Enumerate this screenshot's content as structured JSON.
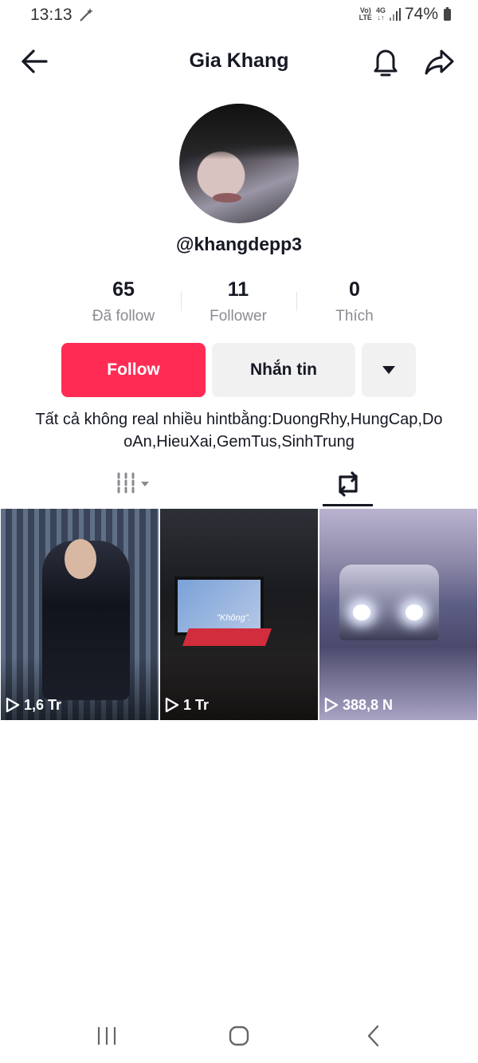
{
  "status_bar": {
    "time": "13:13",
    "network_top": "Vo)",
    "network_bottom": "LTE",
    "network_type": "4G",
    "battery_percent": "74%"
  },
  "header": {
    "title": "Gia Khang",
    "icons": [
      "back-arrow-icon",
      "bell-icon",
      "share-icon"
    ]
  },
  "profile": {
    "handle": "@khangdepp3",
    "stats": [
      {
        "value": "65",
        "label": "Đã follow"
      },
      {
        "value": "11",
        "label": "Follower"
      },
      {
        "value": "0",
        "label": "Thích"
      }
    ],
    "bio": "Tất cả không real nhiều hintbằng:DuongRhy,HungCap,DooAn,HieuXai,GemTus,SinhTrung"
  },
  "actions": {
    "follow_label": "Follow",
    "message_label": "Nhắn tin"
  },
  "colors": {
    "follow_bg": "#fe2c55",
    "secondary_bg": "#f1f1f2",
    "text": "#161823",
    "muted": "#8a8b91"
  },
  "videos": [
    {
      "views": "1,6 Tr"
    },
    {
      "views": "1 Tr",
      "caption": "\"Không\"."
    },
    {
      "views": "388,8 N"
    }
  ]
}
